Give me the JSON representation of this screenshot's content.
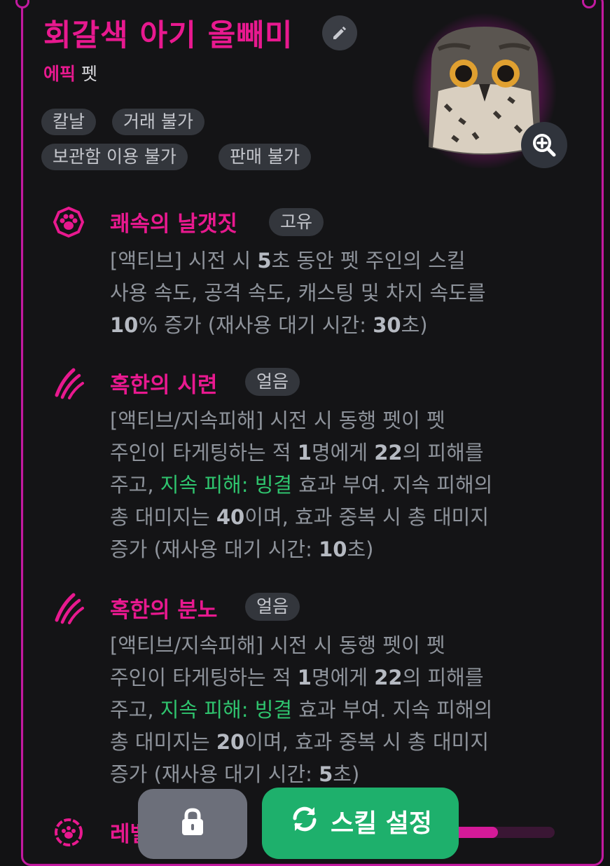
{
  "pet": {
    "name": "회갈색 아기 올빼미",
    "grade": "에픽",
    "type": "펫",
    "tags": [
      "칼날",
      "거래 불가",
      "보관함 이용 불가",
      "판매 불가"
    ]
  },
  "skills": [
    {
      "name": "쾌속의 날갯짓",
      "badge": "고유",
      "icon": "paw-badge-icon",
      "desc": {
        "l1a": "[액티브] 시전 시 ",
        "l1b": "5",
        "l1c": "초 동안 펫 주인의 스킬",
        "l2": "사용 속도, 공격 속도, 캐스팅 및 차지 속도를",
        "l3a": "10",
        "l3b": "% 증가 (재사용 대기 시간: ",
        "l3c": "30",
        "l3d": "초)"
      }
    },
    {
      "name": "혹한의 시련",
      "badge": "얼음",
      "icon": "claw-icon",
      "desc": {
        "l1": "[액티브/지속피해] 시전 시 동행 펫이 펫",
        "l2a": "주인이 타게팅하는 적 ",
        "l2b": "1",
        "l2c": "명에게 ",
        "l2d": "22",
        "l2e": "의 피해를",
        "l3a": "주고, ",
        "l3b": "지속 피해: 빙결",
        "l3c": " 효과 부여. 지속 피해의",
        "l4a": "총 대미지는 ",
        "l4b": "40",
        "l4c": "이며, 효과 중복 시 총 대미지",
        "l5a": "증가 (재사용 대기 시간: ",
        "l5b": "10",
        "l5c": "초)"
      }
    },
    {
      "name": "혹한의 분노",
      "badge": "얼음",
      "icon": "claw-icon",
      "desc": {
        "l1": "[액티브/지속피해] 시전 시 동행 펫이 펫",
        "l2a": "주인이 타게팅하는 적 ",
        "l2b": "1",
        "l2c": "명에게 ",
        "l2d": "22",
        "l2e": "의 피해를",
        "l3a": "주고, ",
        "l3b": "지속 피해: 빙결",
        "l3c": " 효과 부여. 지속 피해의",
        "l4a": "총 대미지는 ",
        "l4b": "20",
        "l4c": "이며, 효과 중복 시 총 대미지",
        "l5a": "증가 (재사용 대기 시간: ",
        "l5b": "5",
        "l5c": "초)"
      }
    }
  ],
  "level": {
    "label_partial": "레벨",
    "progress": 0.47
  },
  "buttons": {
    "skill_settings": "스킬 설정"
  },
  "colors": {
    "accent": "#e8198f",
    "green": "#1eb06c",
    "highlight_green": "#2fc46e"
  }
}
